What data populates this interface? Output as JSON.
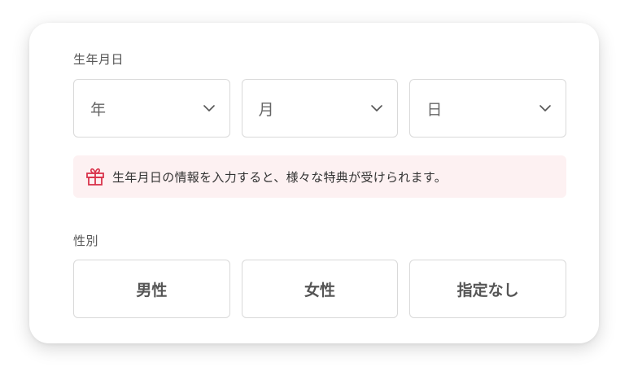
{
  "birthdate": {
    "label": "生年月日",
    "year": {
      "value": "年",
      "icon": "chevron-down-icon"
    },
    "month": {
      "value": "月",
      "icon": "chevron-down-icon"
    },
    "day": {
      "value": "日",
      "icon": "chevron-down-icon"
    },
    "notice": {
      "icon": "gift-icon",
      "text": "生年月日の情報を入力すると、様々な特典が受けられます。"
    }
  },
  "gender": {
    "label": "性別",
    "options": [
      "男性",
      "女性",
      "指定なし"
    ]
  },
  "colors": {
    "notice_background": "#fdf1f2",
    "gift_icon": "#d9334b",
    "border": "#d9d9d9",
    "text": "#555555"
  }
}
